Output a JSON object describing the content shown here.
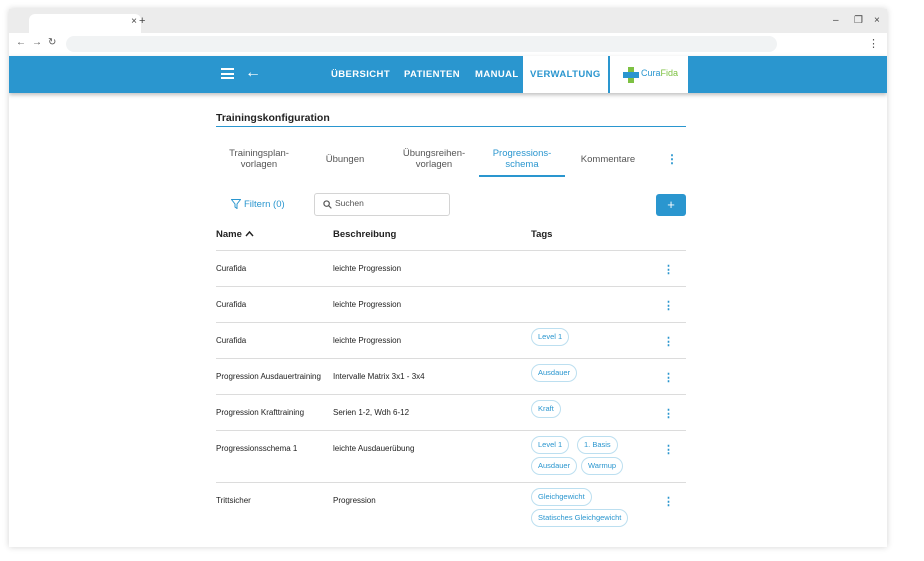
{
  "browser": {
    "tab_close": "×",
    "new_tab": "+",
    "window_controls": [
      "–",
      "❐",
      "×"
    ],
    "nav_back": "←",
    "nav_forward": "→",
    "nav_reload": "↻",
    "menu": "⋮"
  },
  "header": {
    "back": "←",
    "nav": [
      "ÜBERSICHT",
      "PATIENTEN",
      "MANUAL",
      "VERWALTUNG"
    ],
    "active_nav": "VERWALTUNG",
    "logo": {
      "text_a": "Cura",
      "text_b": "Fida"
    },
    "colors": {
      "primary": "#2a96cf",
      "logo_green": "#7dc142"
    }
  },
  "page": {
    "title": "Trainingskonfiguration",
    "subtabs": [
      {
        "line1": "Trainingsplan-",
        "line2": "vorlagen"
      },
      {
        "line1": "Übungen",
        "line2": ""
      },
      {
        "line1": "Übungsreihen-",
        "line2": "vorlagen"
      },
      {
        "line1": "Progressions-",
        "line2": "schema"
      },
      {
        "line1": "Kommentare",
        "line2": ""
      }
    ],
    "active_subtab": "Progressions-schema",
    "subtab_more": "⋮"
  },
  "toolbar": {
    "filter_label": "Filtern (0)",
    "search_placeholder": "Suchen",
    "add_label": "+"
  },
  "table": {
    "columns": [
      "Name",
      "Beschreibung",
      "Tags"
    ],
    "sort_indicator": "ascending",
    "row_menu": "⋮",
    "rows": [
      {
        "name": "Curafida",
        "description": "leichte Progression",
        "tags": []
      },
      {
        "name": "Curafida",
        "description": "leichte Progression",
        "tags": []
      },
      {
        "name": "Curafida",
        "description": "leichte Progression",
        "tags": [
          "Level 1"
        ]
      },
      {
        "name": "Progression Ausdauertraining",
        "description": "Intervalle Matrix 3x1 - 3x4",
        "tags": [
          "Ausdauer"
        ]
      },
      {
        "name": "Progression Krafttraining",
        "description": "Serien 1-2, Wdh 6-12",
        "tags": [
          "Kraft"
        ]
      },
      {
        "name": "Progressionsschema 1",
        "description": "leichte Ausdauerübung",
        "tags": [
          "Level 1",
          "1. Basis",
          "Ausdauer",
          "Warmup"
        ]
      },
      {
        "name": "Trittsicher",
        "description": "Progression",
        "tags": [
          "Gleichgewicht",
          "Statisches Gleichgewicht"
        ]
      }
    ]
  }
}
